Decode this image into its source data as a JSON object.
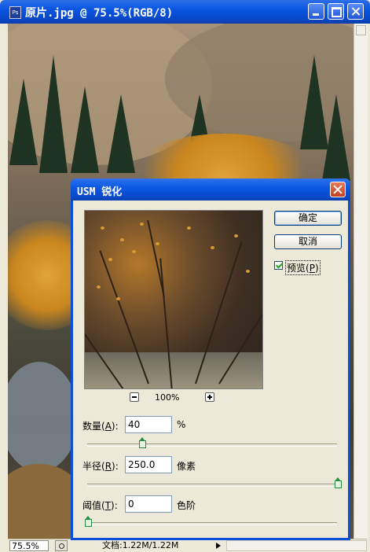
{
  "window": {
    "icon_label": "Ps",
    "title": "原片.jpg @ 75.5%(RGB/8)"
  },
  "status": {
    "zoom": "75.5%",
    "doc_size": "文档:1.22M/1.22M"
  },
  "dialog": {
    "title": "USM 锐化",
    "ok_label": "确定",
    "cancel_label": "取消",
    "preview_label": "预览",
    "preview_key": "P",
    "preview_checked": true,
    "preview_zoom": "100%",
    "amount": {
      "label": "数量",
      "key": "A",
      "value": "40",
      "unit": "%",
      "slider_fraction": 0.19
    },
    "radius": {
      "label": "半径",
      "key": "R",
      "value": "250.0",
      "unit": "像素",
      "slider_fraction": 1.0
    },
    "threshold": {
      "label": "阈值",
      "key": "T",
      "value": "0",
      "unit": "色阶",
      "slider_fraction": 0.0
    }
  }
}
